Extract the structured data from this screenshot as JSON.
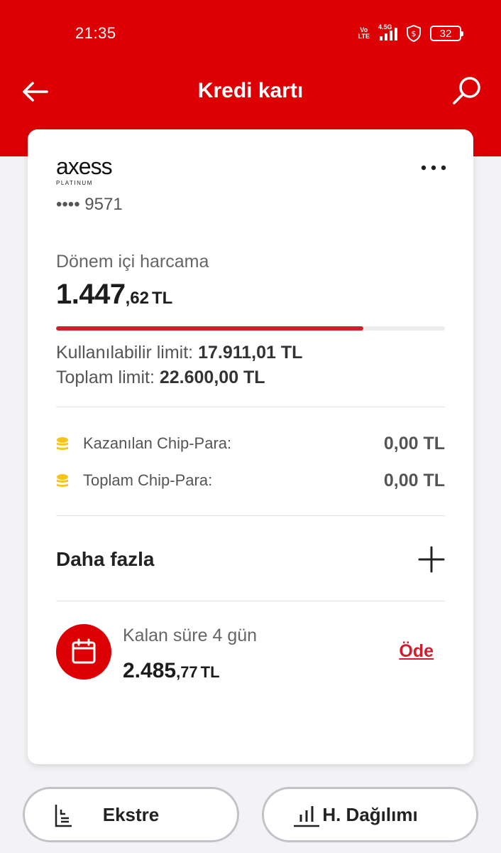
{
  "status_bar": {
    "time": "21:35",
    "volte_top": "Vo",
    "volte_bottom": "LTE",
    "network": "4.5G",
    "battery": "32"
  },
  "app_bar": {
    "title": "Kredi kartı",
    "back_icon": "arrow-left-icon",
    "search_icon": "search-icon"
  },
  "card": {
    "brand": "axess",
    "tier": "PLATINUM",
    "number": "•••• 9571",
    "more_icon": "more-horizontal-icon",
    "period_label": "Dönem içi harcama",
    "period_amount": {
      "integer": "1.447",
      "decimal": ",62",
      "currency": "TL"
    },
    "usage_fraction": 0.79,
    "available_limit": {
      "label": "Kullanılabilir limit:",
      "value": "17.911,01 TL"
    },
    "total_limit": {
      "label": "Toplam limit:",
      "value": "22.600,00 TL"
    },
    "chip_rows": [
      {
        "label": "Kazanılan Chip-Para:",
        "value": "0,00 TL",
        "icon": "coin-stack-icon"
      },
      {
        "label": "Toplam Chip-Para:",
        "value": "0,00 TL",
        "icon": "coin-stack-icon"
      }
    ],
    "more_label": "Daha fazla",
    "payment": {
      "label": "Kalan süre 4 gün",
      "amount": {
        "integer": "2.485",
        "decimal": ",77",
        "currency": "TL"
      },
      "action": "Öde",
      "icon": "calendar-icon"
    }
  },
  "bottom_actions": [
    {
      "label": "Ekstre",
      "icon": "statement-icon"
    },
    {
      "label": "H. Dağılımı",
      "icon": "bar-chart-icon"
    }
  ],
  "colors": {
    "brand_red": "#dc0005",
    "accent_red": "#d01e2b",
    "coin_yellow": "#f4c51a"
  }
}
